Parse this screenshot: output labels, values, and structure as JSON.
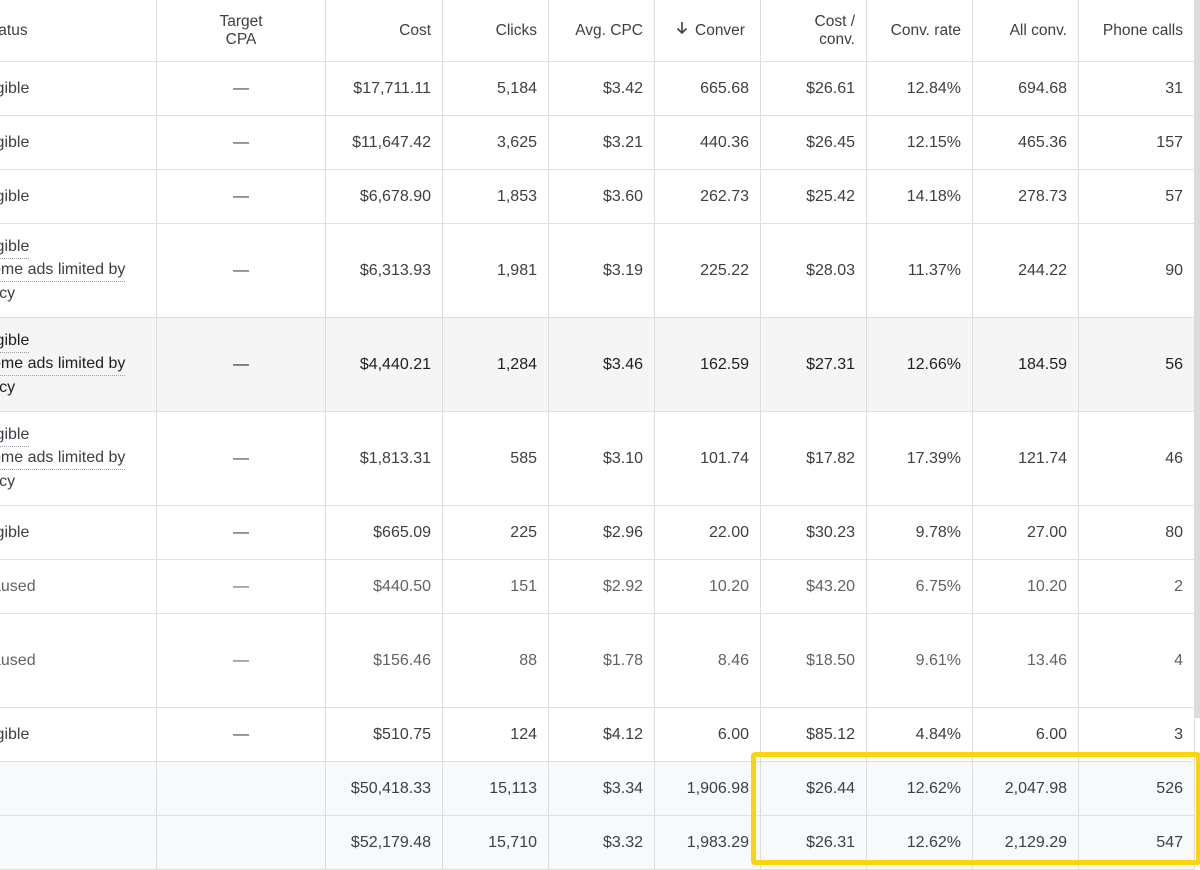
{
  "header": {
    "status": "tatus",
    "target_cpa_line1": "Target",
    "target_cpa_line2": "CPA",
    "cost": "Cost",
    "clicks": "Clicks",
    "avg_cpc": "Avg. CPC",
    "conversions": "Conver",
    "sort_icon": "arrow-down-icon",
    "cost_per_conv_line1": "Cost /",
    "cost_per_conv_line2": "conv.",
    "conv_rate": "Conv. rate",
    "all_conv": "All conv.",
    "phone_calls": "Phone calls"
  },
  "rows": [
    {
      "status": [
        "igible"
      ],
      "target_cpa": "—",
      "cost": "$17,711.11",
      "clicks": "5,184",
      "avg_cpc": "$3.42",
      "conversions": "665.68",
      "cost_per_conv": "$26.61",
      "conv_rate": "12.84%",
      "all_conv": "694.68",
      "phone_calls": "31"
    },
    {
      "status": [
        "igible"
      ],
      "target_cpa": "—",
      "cost": "$11,647.42",
      "clicks": "3,625",
      "avg_cpc": "$3.21",
      "conversions": "440.36",
      "cost_per_conv": "$26.45",
      "conv_rate": "12.15%",
      "all_conv": "465.36",
      "phone_calls": "157"
    },
    {
      "status": [
        "igible"
      ],
      "target_cpa": "—",
      "cost": "$6,678.90",
      "clicks": "1,853",
      "avg_cpc": "$3.60",
      "conversions": "262.73",
      "cost_per_conv": "$25.42",
      "conv_rate": "14.18%",
      "all_conv": "278.73",
      "phone_calls": "57"
    },
    {
      "status": [
        "igible",
        "ome ads limited by",
        "licy"
      ],
      "target_cpa": "—",
      "cost": "$6,313.93",
      "clicks": "1,981",
      "avg_cpc": "$3.19",
      "conversions": "225.22",
      "cost_per_conv": "$28.03",
      "conv_rate": "11.37%",
      "all_conv": "244.22",
      "phone_calls": "90"
    },
    {
      "status": [
        "igible",
        "ome ads limited by",
        "licy"
      ],
      "target_cpa": "—",
      "cost": "$4,440.21",
      "clicks": "1,284",
      "avg_cpc": "$3.46",
      "conversions": "162.59",
      "cost_per_conv": "$27.31",
      "conv_rate": "12.66%",
      "all_conv": "184.59",
      "phone_calls": "56"
    },
    {
      "status": [
        "igible",
        "ome ads limited by",
        "licy"
      ],
      "target_cpa": "—",
      "cost": "$1,813.31",
      "clicks": "585",
      "avg_cpc": "$3.10",
      "conversions": "101.74",
      "cost_per_conv": "$17.82",
      "conv_rate": "17.39%",
      "all_conv": "121.74",
      "phone_calls": "46"
    },
    {
      "status": [
        "igible"
      ],
      "target_cpa": "—",
      "cost": "$665.09",
      "clicks": "225",
      "avg_cpc": "$2.96",
      "conversions": "22.00",
      "cost_per_conv": "$30.23",
      "conv_rate": "9.78%",
      "all_conv": "27.00",
      "phone_calls": "80"
    },
    {
      "status": [
        "aused"
      ],
      "target_cpa": "—",
      "cost": "$440.50",
      "clicks": "151",
      "avg_cpc": "$2.92",
      "conversions": "10.20",
      "cost_per_conv": "$43.20",
      "conv_rate": "6.75%",
      "all_conv": "10.20",
      "phone_calls": "2"
    },
    {
      "status": [
        "aused"
      ],
      "target_cpa": "—",
      "cost": "$156.46",
      "clicks": "88",
      "avg_cpc": "$1.78",
      "conversions": "8.46",
      "cost_per_conv": "$18.50",
      "conv_rate": "9.61%",
      "all_conv": "13.46",
      "phone_calls": "4"
    },
    {
      "status": [
        "igible"
      ],
      "target_cpa": "—",
      "cost": "$510.75",
      "clicks": "124",
      "avg_cpc": "$4.12",
      "conversions": "6.00",
      "cost_per_conv": "$85.12",
      "conv_rate": "4.84%",
      "all_conv": "6.00",
      "phone_calls": "3"
    }
  ],
  "totals": [
    {
      "cost": "$50,418.33",
      "clicks": "15,113",
      "avg_cpc": "$3.34",
      "conversions": "1,906.98",
      "cost_per_conv": "$26.44",
      "conv_rate": "12.62%",
      "all_conv": "2,047.98",
      "phone_calls": "526"
    },
    {
      "cost": "$52,179.48",
      "clicks": "15,710",
      "avg_cpc": "$3.32",
      "conversions": "1,983.29",
      "cost_per_conv": "$26.31",
      "conv_rate": "12.62%",
      "all_conv": "2,129.29",
      "phone_calls": "547"
    }
  ],
  "colors": {
    "highlight_border": "#fbd40b",
    "row_highlight": "#f5f5f5",
    "grid_line": "#dadce0",
    "text": "#3c4043"
  }
}
